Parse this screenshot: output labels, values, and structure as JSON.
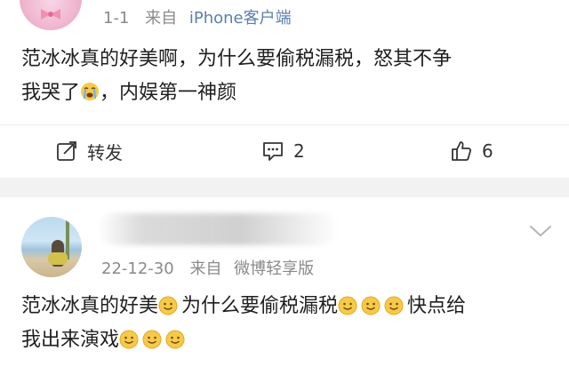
{
  "post1": {
    "time": "1-1",
    "source_prefix": "来自",
    "source": "iPhone客户端",
    "content_line1": "范冰冰真的好美啊，为什么要偷税漏税，怒其不争",
    "content_line2a": "我哭了",
    "content_line2b": "，内娱第一神颜",
    "emoji": "crying-face-icon",
    "actions": {
      "repost_label": "转发",
      "comment_count": "2",
      "like_count": "6"
    }
  },
  "post2": {
    "time": "22-12-30",
    "source_prefix": "来自",
    "source": "微博轻享版",
    "content_part1": "范冰冰真的好美",
    "content_part2": "为什么要偷税漏税",
    "content_part3": "快点给",
    "content_part4": "我出来演戏",
    "emoji": "smile-face-icon"
  },
  "colors": {
    "meta_gray": "#8a8a8a",
    "source_blue": "#5b7fb0",
    "separator": "#f2f2f2",
    "emoji_yellow": "#f7c948"
  }
}
